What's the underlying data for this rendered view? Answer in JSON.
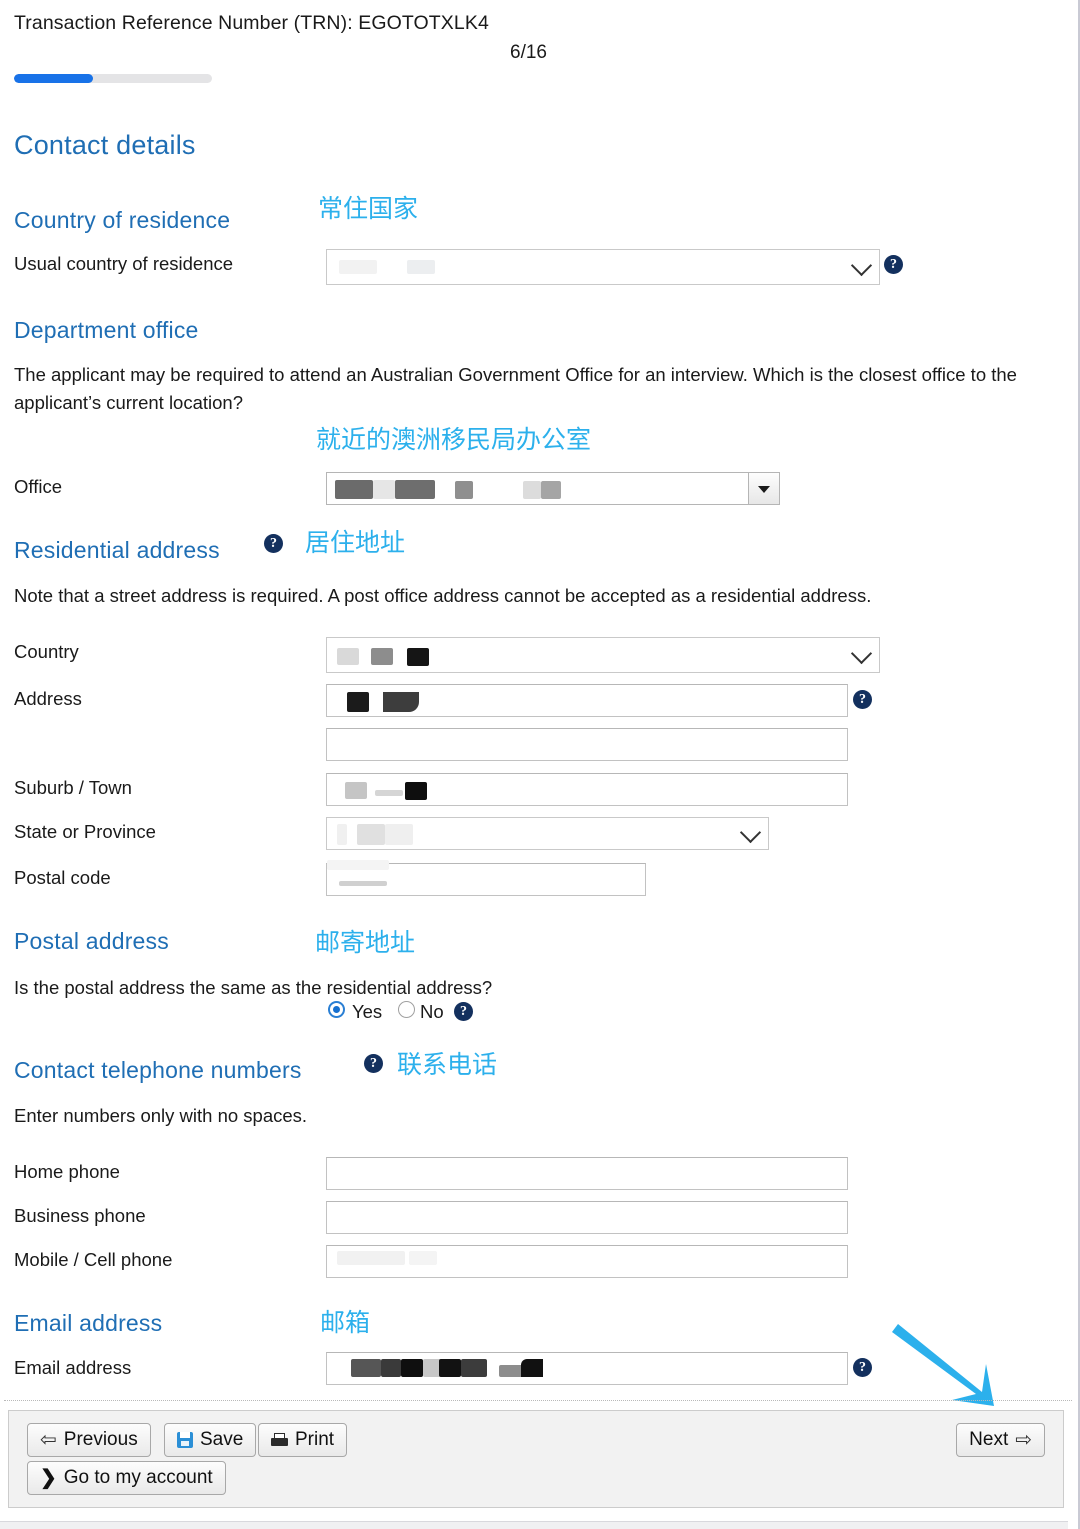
{
  "header": {
    "trn_label": "Transaction Reference Number (TRN): EGOTOTXLK4",
    "page_counter": "6/16",
    "progress_percent": 40,
    "progress_fill_color": "#1872e8",
    "progress_track_color": "#e4e4e6"
  },
  "annotation_color": "#2cb0ec",
  "heading_color": "#1f6eb4",
  "page_title": "Contact details",
  "sections": {
    "country_of_residence": {
      "heading": "Country of residence",
      "annotation_cn": "常住国家",
      "field_label": "Usual country of residence",
      "field_value": "",
      "field_type": "select",
      "help_icon": "question-mark-icon",
      "redacted": true
    },
    "department_office": {
      "heading": "Department office",
      "paragraph": "The applicant may be required to attend an Australian Government Office for an interview. Which is the closest office to the applicant’s current location?",
      "annotation_cn": "就近的澳洲移民局办公室",
      "field_label": "Office",
      "field_value": "",
      "field_type": "native-select",
      "redacted": true
    },
    "residential_address": {
      "heading": "Residential address",
      "help_icon": "question-mark-icon",
      "annotation_cn": "居住地址",
      "note": "Note that a street address is required. A post office address cannot be accepted as a residential address.",
      "fields": [
        {
          "label": "Country",
          "value": "",
          "type": "select",
          "redacted": true,
          "help": false
        },
        {
          "label": "Address",
          "value": "",
          "type": "text",
          "redacted": true,
          "help": true
        },
        {
          "label": "",
          "value": "",
          "type": "text",
          "redacted": false,
          "help": false
        },
        {
          "label": "Suburb / Town",
          "value": "",
          "type": "text",
          "redacted": true,
          "help": false
        },
        {
          "label": "State or Province",
          "value": "",
          "type": "select",
          "redacted": true,
          "help": false
        },
        {
          "label": "Postal code",
          "value": "",
          "type": "text",
          "redacted": true,
          "help": false
        }
      ]
    },
    "postal_address": {
      "heading": "Postal address",
      "annotation_cn": "邮寄地址",
      "question": "Is the postal address the same as the residential address?",
      "options": [
        {
          "label": "Yes",
          "selected": true
        },
        {
          "label": "No",
          "selected": false
        }
      ],
      "help_icon": "question-mark-icon"
    },
    "contact_telephone": {
      "heading": "Contact telephone numbers",
      "help_icon": "question-mark-icon",
      "annotation_cn": "联系电话",
      "note": "Enter numbers only with no spaces.",
      "fields": [
        {
          "label": "Home phone",
          "value": "",
          "redacted": false
        },
        {
          "label": "Business phone",
          "value": "",
          "redacted": false
        },
        {
          "label": "Mobile / Cell phone",
          "value": "",
          "redacted": true
        }
      ]
    },
    "email_address": {
      "heading": "Email address",
      "annotation_cn": "邮箱",
      "field_label": "Email address",
      "field_value": "",
      "redacted": true,
      "help_icon": "question-mark-icon"
    }
  },
  "toolbar": {
    "previous_label": "Previous",
    "save_label": "Save",
    "print_label": "Print",
    "account_label": "Go to my account",
    "next_label": "Next",
    "icons": {
      "previous": "arrow-left-icon",
      "save": "floppy-disk-icon",
      "print": "printer-icon",
      "account": "chevron-right-icon",
      "next": "arrow-right-icon"
    }
  },
  "arrow_annotation": {
    "name": "next-button-pointer-arrow",
    "color": "#2cb0ec"
  }
}
